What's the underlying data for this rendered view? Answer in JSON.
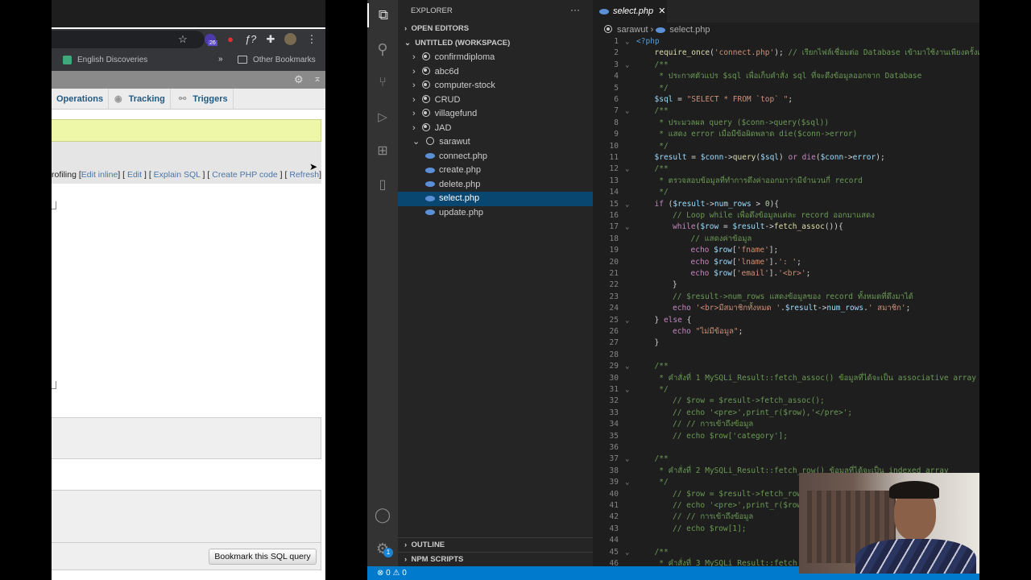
{
  "browser": {
    "extension_badge": "26",
    "bookmarks": {
      "item": "English Discoveries",
      "more": "»",
      "other": "Other Bookmarks"
    },
    "tabs": [
      "Operations",
      "Tracking",
      "Triggers"
    ],
    "links": {
      "prefix": "rofiling [",
      "edit_inline": "Edit inline",
      "edit": "Edit",
      "explain": "Explain SQL",
      "create_php": "Create PHP code",
      "refresh": "Refresh"
    },
    "bookmark_button": "Bookmark this SQL query"
  },
  "vscode": {
    "explorer_title": "EXPLORER",
    "sections": {
      "open_editors": "OPEN EDITORS",
      "workspace": "UNTITLED (WORKSPACE)",
      "outline": "OUTLINE",
      "npm": "NPM SCRIPTS"
    },
    "folders": [
      "confirmdiploma",
      "abc6d",
      "computer-stock",
      "CRUD",
      "villagefund",
      "JAD"
    ],
    "open_folder": "sarawut",
    "files": [
      "connect.php",
      "create.php",
      "delete.php",
      "select.php",
      "update.php"
    ],
    "selected_file": "select.php",
    "tab": "select.php",
    "breadcrumb": [
      "sarawut",
      "select.php"
    ],
    "settings_badge": "1",
    "status": {
      "errors": "0",
      "warnings": "0"
    },
    "code": [
      {
        "n": "1",
        "f": true,
        "i": 0,
        "t": [
          [
            "tag",
            "<?php"
          ]
        ]
      },
      {
        "n": "2",
        "i": 1,
        "t": [
          [
            "fn",
            "require_once"
          ],
          [
            "p",
            "("
          ],
          [
            "str",
            "'connect.php'"
          ],
          [
            "p",
            "); "
          ],
          [
            "cm",
            "// เรียกไฟล์เชื่อมต่อ Database เข้ามาใช้งานเพียงครั้งเดียว"
          ]
        ]
      },
      {
        "n": "3",
        "f": true,
        "i": 1,
        "t": [
          [
            "cm",
            "/**"
          ]
        ]
      },
      {
        "n": "4",
        "i": 1,
        "t": [
          [
            "cm",
            " * ประกาศตัวแปร $sql เพื่อเก็บคำสั่ง sql ที่จะดึงข้อมูลออกจาก Database"
          ]
        ]
      },
      {
        "n": "5",
        "i": 1,
        "t": [
          [
            "cm",
            " */"
          ]
        ]
      },
      {
        "n": "6",
        "i": 1,
        "t": [
          [
            "var",
            "$sql"
          ],
          [
            "p",
            " = "
          ],
          [
            "str",
            "\"SELECT * FROM `top` \""
          ],
          [
            "p",
            ";"
          ]
        ]
      },
      {
        "n": "7",
        "f": true,
        "i": 1,
        "t": [
          [
            "cm",
            "/**"
          ]
        ]
      },
      {
        "n": "8",
        "i": 1,
        "t": [
          [
            "cm",
            " * ประมวลผล query ($conn->query($sql))"
          ]
        ]
      },
      {
        "n": "9",
        "i": 1,
        "t": [
          [
            "cm",
            " * แสดง error เมื่อมีข้อผิดพลาด die($conn->error)"
          ]
        ]
      },
      {
        "n": "10",
        "i": 1,
        "t": [
          [
            "cm",
            " */"
          ]
        ]
      },
      {
        "n": "11",
        "i": 1,
        "t": [
          [
            "var",
            "$result"
          ],
          [
            "p",
            " = "
          ],
          [
            "var",
            "$conn"
          ],
          [
            "p",
            "->"
          ],
          [
            "fn",
            "query"
          ],
          [
            "p",
            "("
          ],
          [
            "var",
            "$sql"
          ],
          [
            "p",
            ") "
          ],
          [
            "kw",
            "or"
          ],
          [
            "p",
            " "
          ],
          [
            "kw",
            "die"
          ],
          [
            "p",
            "("
          ],
          [
            "var",
            "$conn"
          ],
          [
            "p",
            "->"
          ],
          [
            "var",
            "error"
          ],
          [
            "p",
            ");"
          ]
        ]
      },
      {
        "n": "12",
        "f": true,
        "i": 1,
        "t": [
          [
            "cm",
            "/**"
          ]
        ]
      },
      {
        "n": "13",
        "i": 1,
        "t": [
          [
            "cm",
            " * ตรวจสอบข้อมูลที่ทำการดึงค่าออกมาว่ามีจำนวนกี่ record"
          ]
        ]
      },
      {
        "n": "14",
        "i": 1,
        "t": [
          [
            "cm",
            " */"
          ]
        ]
      },
      {
        "n": "15",
        "f": true,
        "i": 1,
        "t": [
          [
            "kw",
            "if"
          ],
          [
            "p",
            " ("
          ],
          [
            "var",
            "$result"
          ],
          [
            "p",
            "->"
          ],
          [
            "var",
            "num_rows"
          ],
          [
            "p",
            " > "
          ],
          [
            "num",
            "0"
          ],
          [
            "p",
            "){"
          ]
        ]
      },
      {
        "n": "16",
        "i": 2,
        "t": [
          [
            "cm",
            "// Loop while เพื่อดึงข้อมูลแต่ละ record ออกมาแสดง"
          ]
        ]
      },
      {
        "n": "17",
        "f": true,
        "i": 2,
        "t": [
          [
            "kw",
            "while"
          ],
          [
            "p",
            "("
          ],
          [
            "var",
            "$row"
          ],
          [
            "p",
            " = "
          ],
          [
            "var",
            "$result"
          ],
          [
            "p",
            "->"
          ],
          [
            "fn",
            "fetch_assoc"
          ],
          [
            "p",
            "()){"
          ]
        ]
      },
      {
        "n": "18",
        "i": 3,
        "t": [
          [
            "cm",
            "// แสดงค่าข้อมูล"
          ]
        ]
      },
      {
        "n": "19",
        "i": 3,
        "t": [
          [
            "kw",
            "echo"
          ],
          [
            "p",
            " "
          ],
          [
            "var",
            "$row"
          ],
          [
            "p",
            "["
          ],
          [
            "str",
            "'fname'"
          ],
          [
            "p",
            "];"
          ]
        ]
      },
      {
        "n": "20",
        "i": 3,
        "t": [
          [
            "kw",
            "echo"
          ],
          [
            "p",
            " "
          ],
          [
            "var",
            "$row"
          ],
          [
            "p",
            "["
          ],
          [
            "str",
            "'lname'"
          ],
          [
            "p",
            "]."
          ],
          [
            "str",
            "': '"
          ],
          [
            "p",
            ";"
          ]
        ]
      },
      {
        "n": "21",
        "i": 3,
        "t": [
          [
            "kw",
            "echo"
          ],
          [
            "p",
            " "
          ],
          [
            "var",
            "$row"
          ],
          [
            "p",
            "["
          ],
          [
            "str",
            "'email'"
          ],
          [
            "p",
            "]."
          ],
          [
            "str",
            "'<br>'"
          ],
          [
            "p",
            ";"
          ]
        ]
      },
      {
        "n": "22",
        "i": 2,
        "t": [
          [
            "p",
            "}"
          ]
        ]
      },
      {
        "n": "23",
        "i": 2,
        "t": [
          [
            "cm",
            "// $result->num_rows แสดงข้อมูลของ record ทั้งหมดที่ดึงมาได้"
          ]
        ]
      },
      {
        "n": "24",
        "i": 2,
        "t": [
          [
            "kw",
            "echo"
          ],
          [
            "p",
            " "
          ],
          [
            "str",
            "'<br>มีสมาชิกทั้งหมด '"
          ],
          [
            "p",
            "."
          ],
          [
            "var",
            "$result"
          ],
          [
            "p",
            "->"
          ],
          [
            "var",
            "num_rows"
          ],
          [
            "p",
            "."
          ],
          [
            "str",
            "' สมาชิก'"
          ],
          [
            "p",
            ";"
          ]
        ]
      },
      {
        "n": "25",
        "f": true,
        "i": 1,
        "t": [
          [
            "p",
            "} "
          ],
          [
            "kw",
            "else"
          ],
          [
            "p",
            " {"
          ]
        ]
      },
      {
        "n": "26",
        "i": 2,
        "t": [
          [
            "kw",
            "echo"
          ],
          [
            "p",
            " "
          ],
          [
            "str",
            "\"ไม่มีข้อมูล\""
          ],
          [
            "p",
            ";"
          ]
        ]
      },
      {
        "n": "27",
        "i": 1,
        "t": [
          [
            "p",
            "}"
          ]
        ]
      },
      {
        "n": "28",
        "i": 0,
        "t": []
      },
      {
        "n": "29",
        "f": true,
        "i": 1,
        "t": [
          [
            "cm",
            "/**"
          ]
        ]
      },
      {
        "n": "30",
        "i": 1,
        "t": [
          [
            "cm",
            " * คำสั่งที่ 1 MySQLi_Result::fetch_assoc() ข้อมูลที่ได้จะเป็น associative array"
          ]
        ]
      },
      {
        "n": "31",
        "f": true,
        "i": 1,
        "t": [
          [
            "cm",
            " */"
          ]
        ]
      },
      {
        "n": "32",
        "i": 2,
        "t": [
          [
            "cm",
            "// $row = $result->fetch_assoc();"
          ]
        ]
      },
      {
        "n": "33",
        "i": 2,
        "t": [
          [
            "cm",
            "// echo '<pre>',print_r($row),'</pre>';"
          ]
        ]
      },
      {
        "n": "34",
        "i": 2,
        "t": [
          [
            "cm",
            "// // การเข้าถึงข้อมูล"
          ]
        ]
      },
      {
        "n": "35",
        "i": 2,
        "t": [
          [
            "cm",
            "// echo $row['category'];"
          ]
        ]
      },
      {
        "n": "36",
        "i": 0,
        "t": []
      },
      {
        "n": "37",
        "f": true,
        "i": 1,
        "t": [
          [
            "cm",
            "/**"
          ]
        ]
      },
      {
        "n": "38",
        "i": 1,
        "t": [
          [
            "cm",
            " * คำสั่งที่ 2 MySQLi_Result::fetch_row() ข้อมูลที่ได้จะเป็น indexed array"
          ]
        ]
      },
      {
        "n": "39",
        "f": true,
        "i": 1,
        "t": [
          [
            "cm",
            " */"
          ]
        ]
      },
      {
        "n": "40",
        "i": 2,
        "t": [
          [
            "cm",
            "// $row = $result->fetch_row();"
          ]
        ]
      },
      {
        "n": "41",
        "i": 2,
        "t": [
          [
            "cm",
            "// echo '<pre>',print_r($row),'</pre>';"
          ]
        ]
      },
      {
        "n": "42",
        "i": 2,
        "t": [
          [
            "cm",
            "// // การเข้าถึงข้อมูล"
          ]
        ]
      },
      {
        "n": "43",
        "i": 2,
        "t": [
          [
            "cm",
            "// echo $row[1];"
          ]
        ]
      },
      {
        "n": "44",
        "i": 0,
        "t": []
      },
      {
        "n": "45",
        "f": true,
        "i": 1,
        "t": [
          [
            "cm",
            "/**"
          ]
        ]
      },
      {
        "n": "46",
        "i": 1,
        "t": [
          [
            "cm",
            " * คำสั่งที่ 3 MySQLi_Result::fetch"
          ]
        ]
      }
    ]
  }
}
